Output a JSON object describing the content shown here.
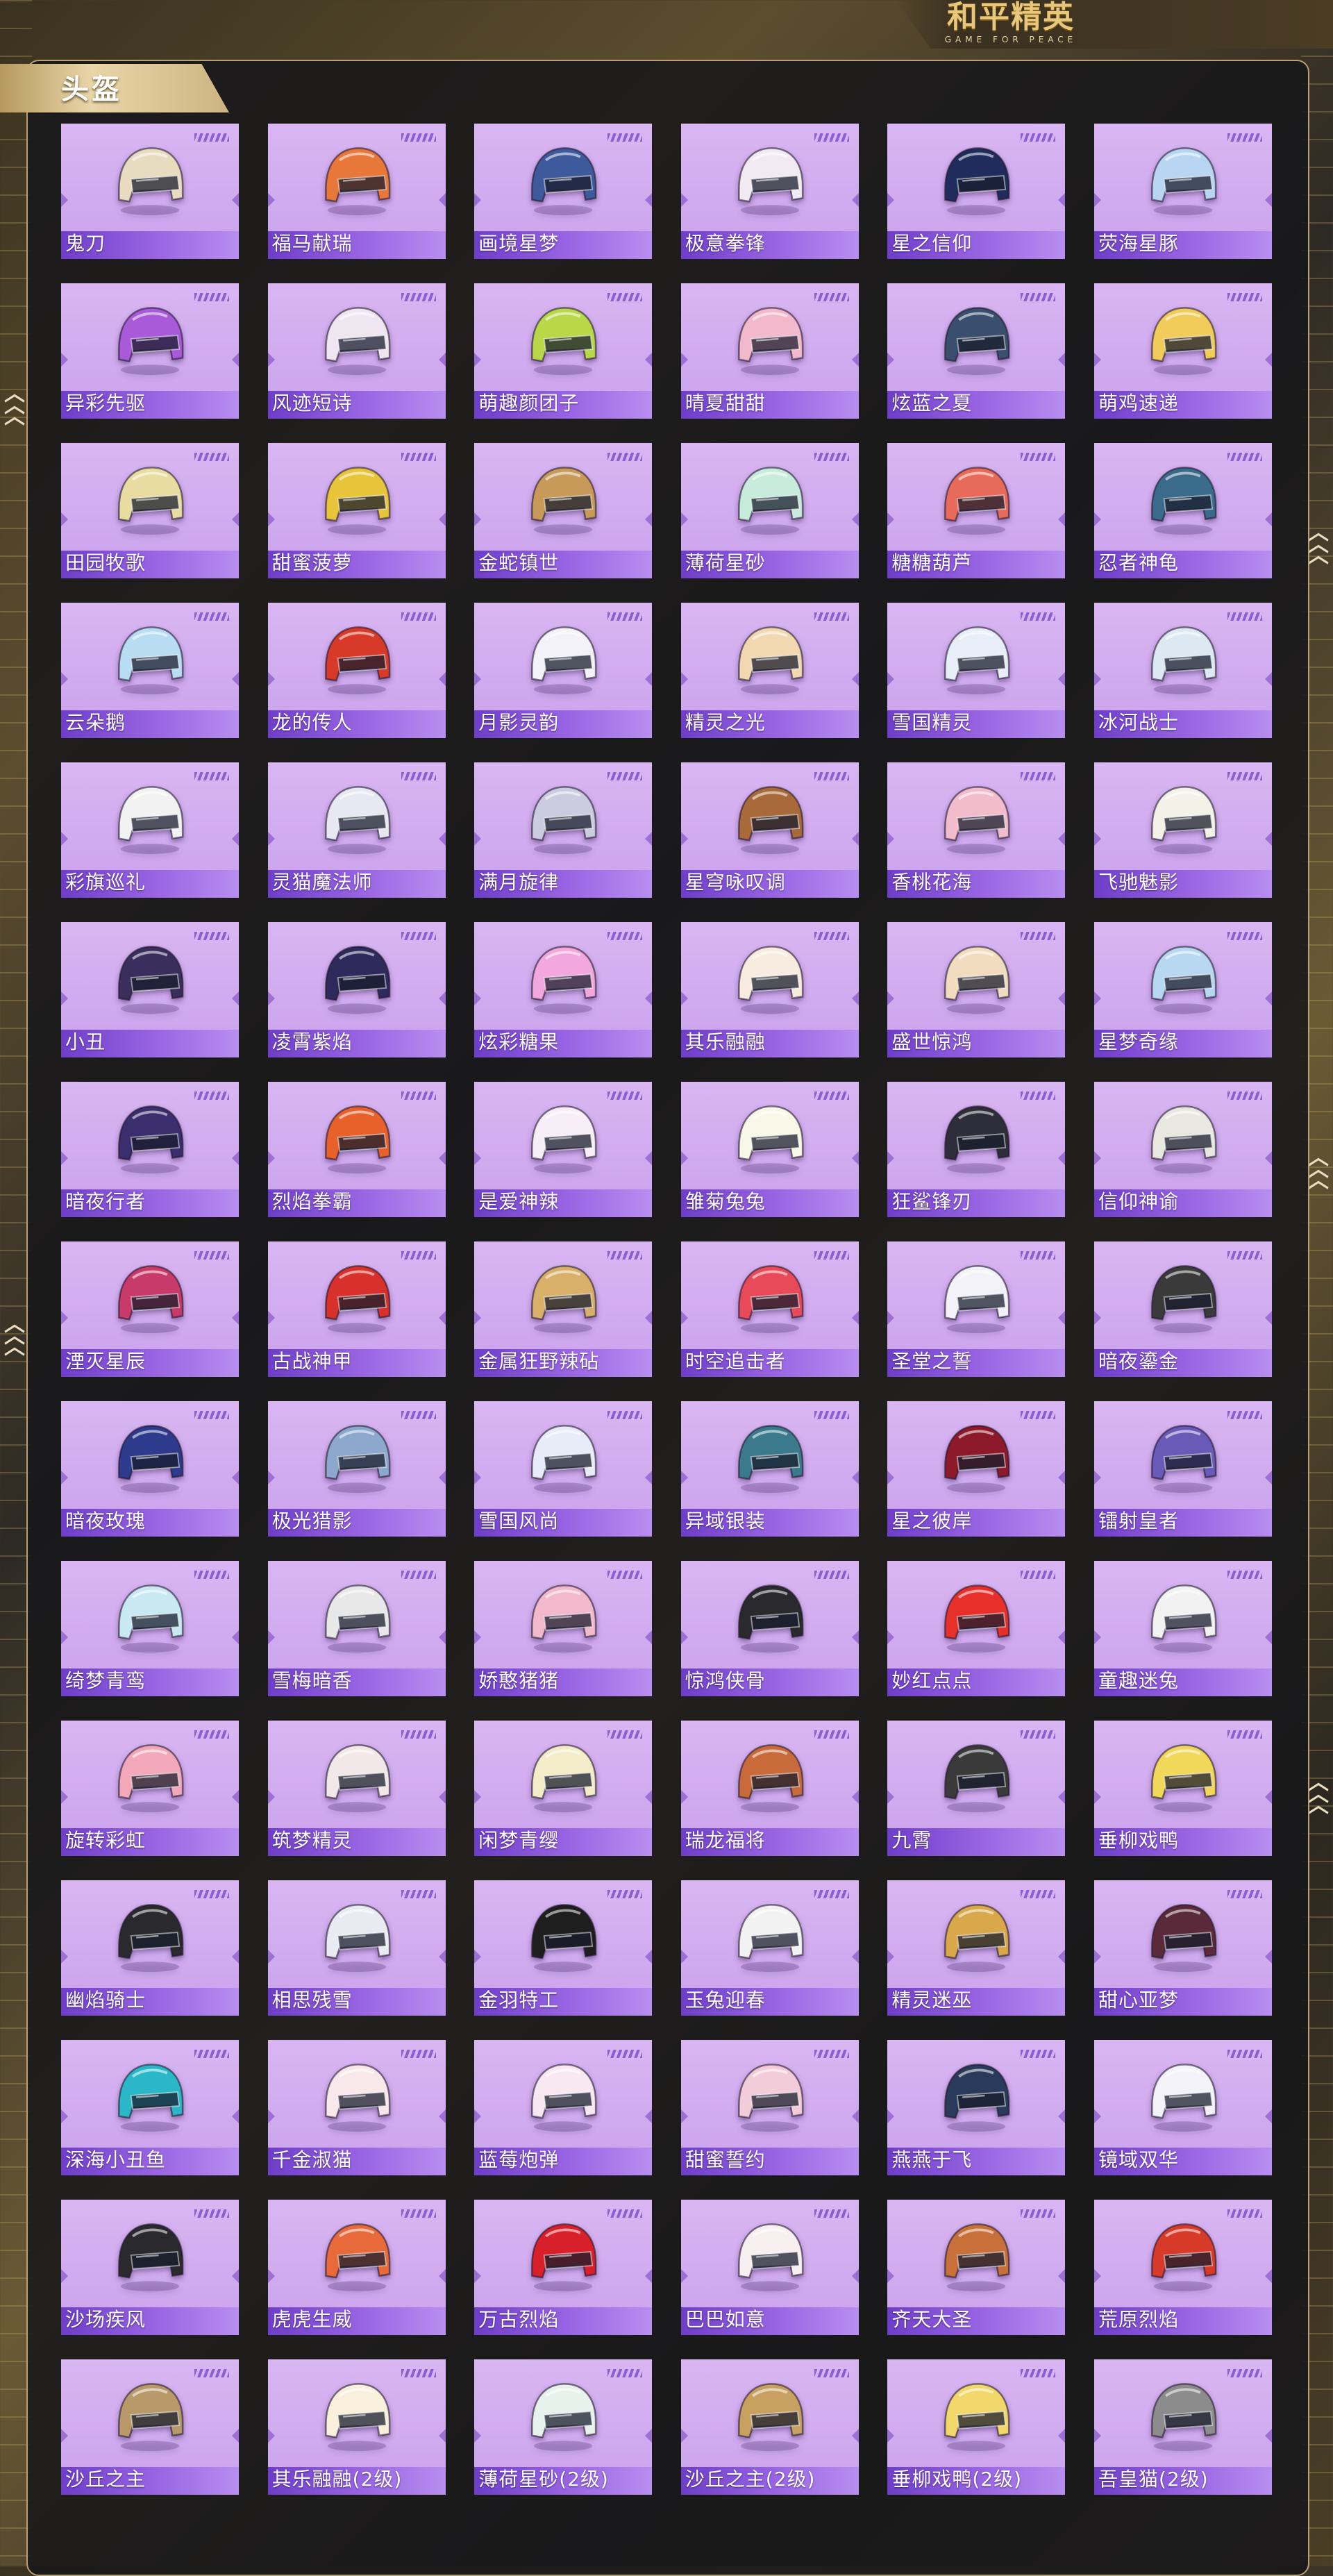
{
  "logo": {
    "title": "和平精英",
    "subtitle": "GAME FOR PEACE"
  },
  "section": {
    "title": "头盔"
  },
  "helmets": [
    {
      "name": "鬼刀",
      "color": "#e8dcc0"
    },
    {
      "name": "福马献瑞",
      "color": "#e8773a"
    },
    {
      "name": "画境星梦",
      "color": "#3f5a9c"
    },
    {
      "name": "极意拳锋",
      "color": "#f2eaf2"
    },
    {
      "name": "星之信仰",
      "color": "#1f2c5c"
    },
    {
      "name": "荧海星豚",
      "color": "#b8d6f2"
    },
    {
      "name": "异彩先驱",
      "color": "#a85ad8"
    },
    {
      "name": "风迹短诗",
      "color": "#f0e6f2"
    },
    {
      "name": "萌趣颜团子",
      "color": "#b8d84a"
    },
    {
      "name": "晴夏甜甜",
      "color": "#f2b8cc"
    },
    {
      "name": "炫蓝之夏",
      "color": "#3a4e6e"
    },
    {
      "name": "萌鸡速递",
      "color": "#f2cc5a"
    },
    {
      "name": "田园牧歌",
      "color": "#e8dca0"
    },
    {
      "name": "甜蜜菠萝",
      "color": "#e8c43a"
    },
    {
      "name": "金蛇镇世",
      "color": "#c89a5a"
    },
    {
      "name": "薄荷星砂",
      "color": "#c8ecdc"
    },
    {
      "name": "糖糖葫芦",
      "color": "#e86a5a"
    },
    {
      "name": "忍者神龟",
      "color": "#3a6a8c"
    },
    {
      "name": "云朵鹅",
      "color": "#b8dcf2"
    },
    {
      "name": "龙的传人",
      "color": "#d83a2a"
    },
    {
      "name": "月影灵韵",
      "color": "#f2f2f8"
    },
    {
      "name": "精灵之光",
      "color": "#f2d8b0"
    },
    {
      "name": "雪国精灵",
      "color": "#e8eef8"
    },
    {
      "name": "冰河战士",
      "color": "#dce8f2"
    },
    {
      "name": "彩旗巡礼",
      "color": "#f2f2f2"
    },
    {
      "name": "灵猫魔法师",
      "color": "#e8e8f2"
    },
    {
      "name": "满月旋律",
      "color": "#cccce0"
    },
    {
      "name": "星穹咏叹调",
      "color": "#a86a3a"
    },
    {
      "name": "香桃花海",
      "color": "#f2bccc"
    },
    {
      "name": "飞驰魅影",
      "color": "#f2f2e8"
    },
    {
      "name": "小丑",
      "color": "#3a2e5c"
    },
    {
      "name": "凌霄紫焰",
      "color": "#2e2a5c"
    },
    {
      "name": "炫彩糖果",
      "color": "#f2a8dc"
    },
    {
      "name": "其乐融融",
      "color": "#f8ece0"
    },
    {
      "name": "盛世惊鸿",
      "color": "#f2dcc0"
    },
    {
      "name": "星梦奇缘",
      "color": "#b8d8f2"
    },
    {
      "name": "暗夜行者",
      "color": "#3a2e6e"
    },
    {
      "name": "烈焰拳霸",
      "color": "#e8602a"
    },
    {
      "name": "是爱神辣",
      "color": "#f8eef8"
    },
    {
      "name": "雏菊兔兔",
      "color": "#f8f8e8"
    },
    {
      "name": "狂鲨锋刃",
      "color": "#2e2e3a"
    },
    {
      "name": "信仰神谕",
      "color": "#e8e8e0"
    },
    {
      "name": "湮灭星辰",
      "color": "#c83a6a"
    },
    {
      "name": "古战神甲",
      "color": "#d8302a"
    },
    {
      "name": "金属狂野辣砧",
      "color": "#d8b06a"
    },
    {
      "name": "时空追击者",
      "color": "#e84a5a"
    },
    {
      "name": "圣堂之誓",
      "color": "#f2f2f8"
    },
    {
      "name": "暗夜鎏金",
      "color": "#3a3a3a"
    },
    {
      "name": "暗夜玫瑰",
      "color": "#2e3a8c"
    },
    {
      "name": "极光猎影",
      "color": "#8ca8cc"
    },
    {
      "name": "雪国风尚",
      "color": "#e8ecf8"
    },
    {
      "name": "异域银装",
      "color": "#3a7a8c"
    },
    {
      "name": "星之彼岸",
      "color": "#8c1a2a"
    },
    {
      "name": "镭射皇者",
      "color": "#6a5ab8"
    },
    {
      "name": "绮梦青鸾",
      "color": "#c8e8f2"
    },
    {
      "name": "雪梅暗香",
      "color": "#e8e8e8"
    },
    {
      "name": "娇憨猪猪",
      "color": "#f2b8cc"
    },
    {
      "name": "惊鸿侠骨",
      "color": "#2a2a2e"
    },
    {
      "name": "妙红点点",
      "color": "#e8302a"
    },
    {
      "name": "童趣迷兔",
      "color": "#f2f2f2"
    },
    {
      "name": "旋转彩虹",
      "color": "#f2a8b8"
    },
    {
      "name": "筑梦精灵",
      "color": "#f2e8e8"
    },
    {
      "name": "闲梦青缨",
      "color": "#f2ecc8"
    },
    {
      "name": "瑞龙福将",
      "color": "#c86a3a"
    },
    {
      "name": "九霄",
      "color": "#3a3a3a"
    },
    {
      "name": "垂柳戏鸭",
      "color": "#f2d85a"
    },
    {
      "name": "幽焰骑士",
      "color": "#2a2a2e"
    },
    {
      "name": "相思残雪",
      "color": "#e8ecf2"
    },
    {
      "name": "金羽特工",
      "color": "#1e1e1e"
    },
    {
      "name": "玉兔迎春",
      "color": "#f2f2f2"
    },
    {
      "name": "精灵迷巫",
      "color": "#d8a84a"
    },
    {
      "name": "甜心亚梦",
      "color": "#5a2a3a"
    },
    {
      "name": "深海小丑鱼",
      "color": "#2ab8c8"
    },
    {
      "name": "千金淑猫",
      "color": "#f8e8ec"
    },
    {
      "name": "蓝莓炮弹",
      "color": "#f8e8f2"
    },
    {
      "name": "甜蜜誓约",
      "color": "#f2ccd8"
    },
    {
      "name": "燕燕于飞",
      "color": "#2a3a5a"
    },
    {
      "name": "镜域双华",
      "color": "#f2f2f8"
    },
    {
      "name": "沙场疾风",
      "color": "#2a2a2e"
    },
    {
      "name": "虎虎生威",
      "color": "#e86a3a"
    },
    {
      "name": "万古烈焰",
      "color": "#d8202a"
    },
    {
      "name": "巴巴如意",
      "color": "#f8f0f0"
    },
    {
      "name": "齐天大圣",
      "color": "#c8703a"
    },
    {
      "name": "荒原烈焰",
      "color": "#d83a2a"
    },
    {
      "name": "沙丘之主",
      "color": "#b89a6a"
    },
    {
      "name": "其乐融融(2级)",
      "color": "#f8f0dc"
    },
    {
      "name": "薄荷星砂(2级)",
      "color": "#e8f2ec"
    },
    {
      "name": "沙丘之主(2级)",
      "color": "#c8a060"
    },
    {
      "name": "垂柳戏鸭(2级)",
      "color": "#f2d86a"
    },
    {
      "name": "吾皇猫(2级)",
      "color": "#8c8c8c"
    }
  ]
}
